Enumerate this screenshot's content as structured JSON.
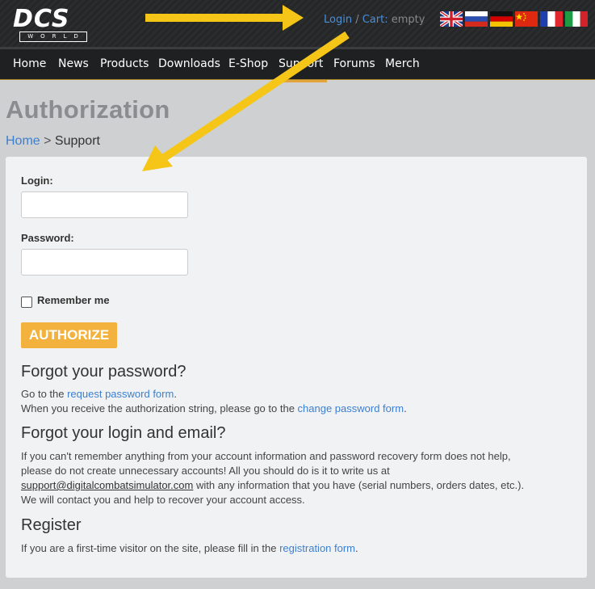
{
  "header": {
    "logo_text": "DCS",
    "logo_sub": "WORLD",
    "login_link": "Login",
    "separator": " / ",
    "cart_label": "Cart:",
    "cart_value": " empty",
    "languages": [
      "English",
      "Russian",
      "German",
      "Chinese",
      "French",
      "Italian"
    ]
  },
  "nav": {
    "items": [
      "Home",
      "News",
      "Products",
      "Downloads",
      "E-Shop",
      "Support",
      "Forums",
      "Merch"
    ],
    "active": "Support"
  },
  "page": {
    "title": "Authorization",
    "breadcrumb": {
      "home": "Home",
      "sep": " > ",
      "current": "Support"
    }
  },
  "form": {
    "login_label": "Login:",
    "login_value": "",
    "password_label": "Password:",
    "password_value": "",
    "remember_label": "Remember me",
    "remember_checked": false,
    "submit_label": "AUTHORIZE"
  },
  "forgot_password": {
    "heading": "Forgot your password?",
    "line1_pre": "Go to the ",
    "line1_link": "request password form",
    "line1_post": ".",
    "line2_pre": "When you receive the authorization string, please go to the ",
    "line2_link": "change password form",
    "line2_post": "."
  },
  "forgot_login": {
    "heading": "Forgot your login and email?",
    "line1": "If you can't remember anything from your account information and password recovery form does not help,",
    "line2": "please do not create unnecessary accounts! All you should do is it to write us at",
    "email": "support@digitalcombatsimulator.com",
    "line3_post": " with any information that you have (serial numbers, orders dates, etc.).",
    "line4": "We will contact you and help to recover your account access."
  },
  "register": {
    "heading": "Register",
    "text_pre": "If you are a first-time visitor on the site, please fill in the ",
    "link": "registration form",
    "text_post": "."
  },
  "colors": {
    "accent": "#f3b23e",
    "link": "#3d7fd0",
    "annotation_arrow": "#f5c518"
  }
}
